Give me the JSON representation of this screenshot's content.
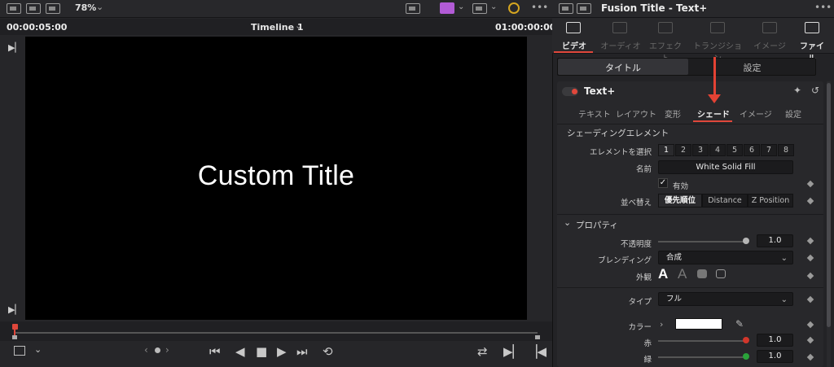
{
  "viewer": {
    "zoom": "78%",
    "timecode_left": "00:00:05:00",
    "timeline_name": "Timeline 1",
    "timecode_right": "01:00:00:00",
    "canvas_title": "Custom Title"
  },
  "inspector": {
    "title": "Fusion Title - Text+",
    "tabs": [
      "ビデオ",
      "オーディオ",
      "エフェクト",
      "トランジション",
      "イメージ",
      "ファイル"
    ],
    "segment": {
      "title": "タイトル",
      "settings": "設定"
    },
    "node_name": "Text+",
    "subtabs": [
      "テキスト",
      "レイアウト",
      "変形",
      "シェード",
      "イメージ",
      "設定"
    ],
    "section_shading": "シェーディングエレメント",
    "labels": {
      "element_select": "エレメントを選択",
      "name": "名前",
      "enabled": "有効",
      "sort": "並べ替え",
      "properties": "プロパティ",
      "opacity": "不透明度",
      "blending": "ブレンディング",
      "appearance": "外観",
      "type": "タイプ",
      "color": "カラー",
      "red": "赤",
      "green": "緑"
    },
    "element_numbers": [
      "1",
      "2",
      "3",
      "4",
      "5",
      "6",
      "7",
      "8"
    ],
    "name_value": "White Solid Fill",
    "sort_options": [
      "優先順位",
      "Distance",
      "Z Position"
    ],
    "opacity_value": "1.0",
    "blending_value": "合成",
    "type_value": "フル",
    "red_value": "1.0",
    "green_value": "1.0",
    "colors": {
      "accent": "#e0473b",
      "fill_color": "#ffffff",
      "green_knob": "#2aa33a"
    }
  }
}
